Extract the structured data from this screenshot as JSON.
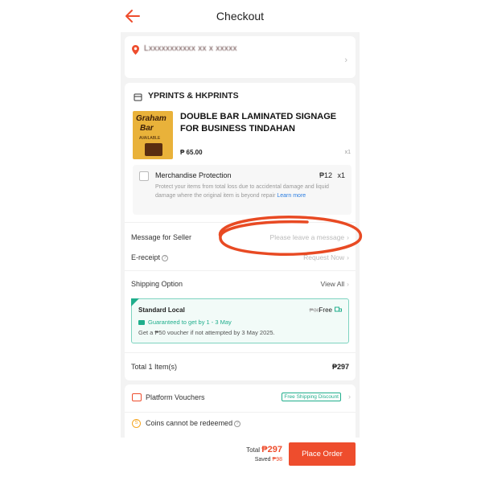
{
  "header": {
    "title": "Checkout",
    "back_icon": "arrow-left-icon"
  },
  "address": {
    "text": "Lxxxxxxxxxxx xx x xxxxx"
  },
  "store": {
    "name": "YPRINTS & HKPRINTS"
  },
  "product": {
    "image_text_1": "Graham",
    "image_text_2": "Bar",
    "image_text_3": "AVAILABLE",
    "title": "DOUBLE BAR LAMINATED SIGNAGE FOR BUSINESS TINDAHAN",
    "price": "₱ 65.00",
    "quantity": "x1"
  },
  "protection": {
    "title": "Merchandise Protection",
    "price": "₱12",
    "quantity": "x1",
    "description": "Protect your items from total loss due to accidental damage and liquid damage where the original item is beyond repair",
    "learn_more": "Learn more",
    "checked": false
  },
  "message": {
    "label": "Message for Seller",
    "placeholder": "Please leave a message"
  },
  "ereceipt": {
    "label": "E-receipt",
    "value": "Request Now"
  },
  "shipping": {
    "label": "Shipping Option",
    "view_all": "View All",
    "method": "Standard Local",
    "original_fee": "₱38",
    "fee": "Free",
    "guarantee": "Guaranteed to get by 1 - 3 May",
    "voucher_note": "Get a ₱50 voucher if not attempted by 3 May 2025."
  },
  "order_total": {
    "label": "Total 1 Item(s)",
    "value": "₱297"
  },
  "vouchers": {
    "label": "Platform Vouchers",
    "tag": "Free Shipping Discount"
  },
  "coins": {
    "label": "Coins cannot be redeemed"
  },
  "footer": {
    "total_label": "Total",
    "total_value": "₱297",
    "saved_label": "Saved",
    "saved_value": "₱98",
    "place_order": "Place Order"
  },
  "colors": {
    "accent": "#ee4d2d",
    "success": "#1fae8c",
    "coin": "#f5a623"
  }
}
